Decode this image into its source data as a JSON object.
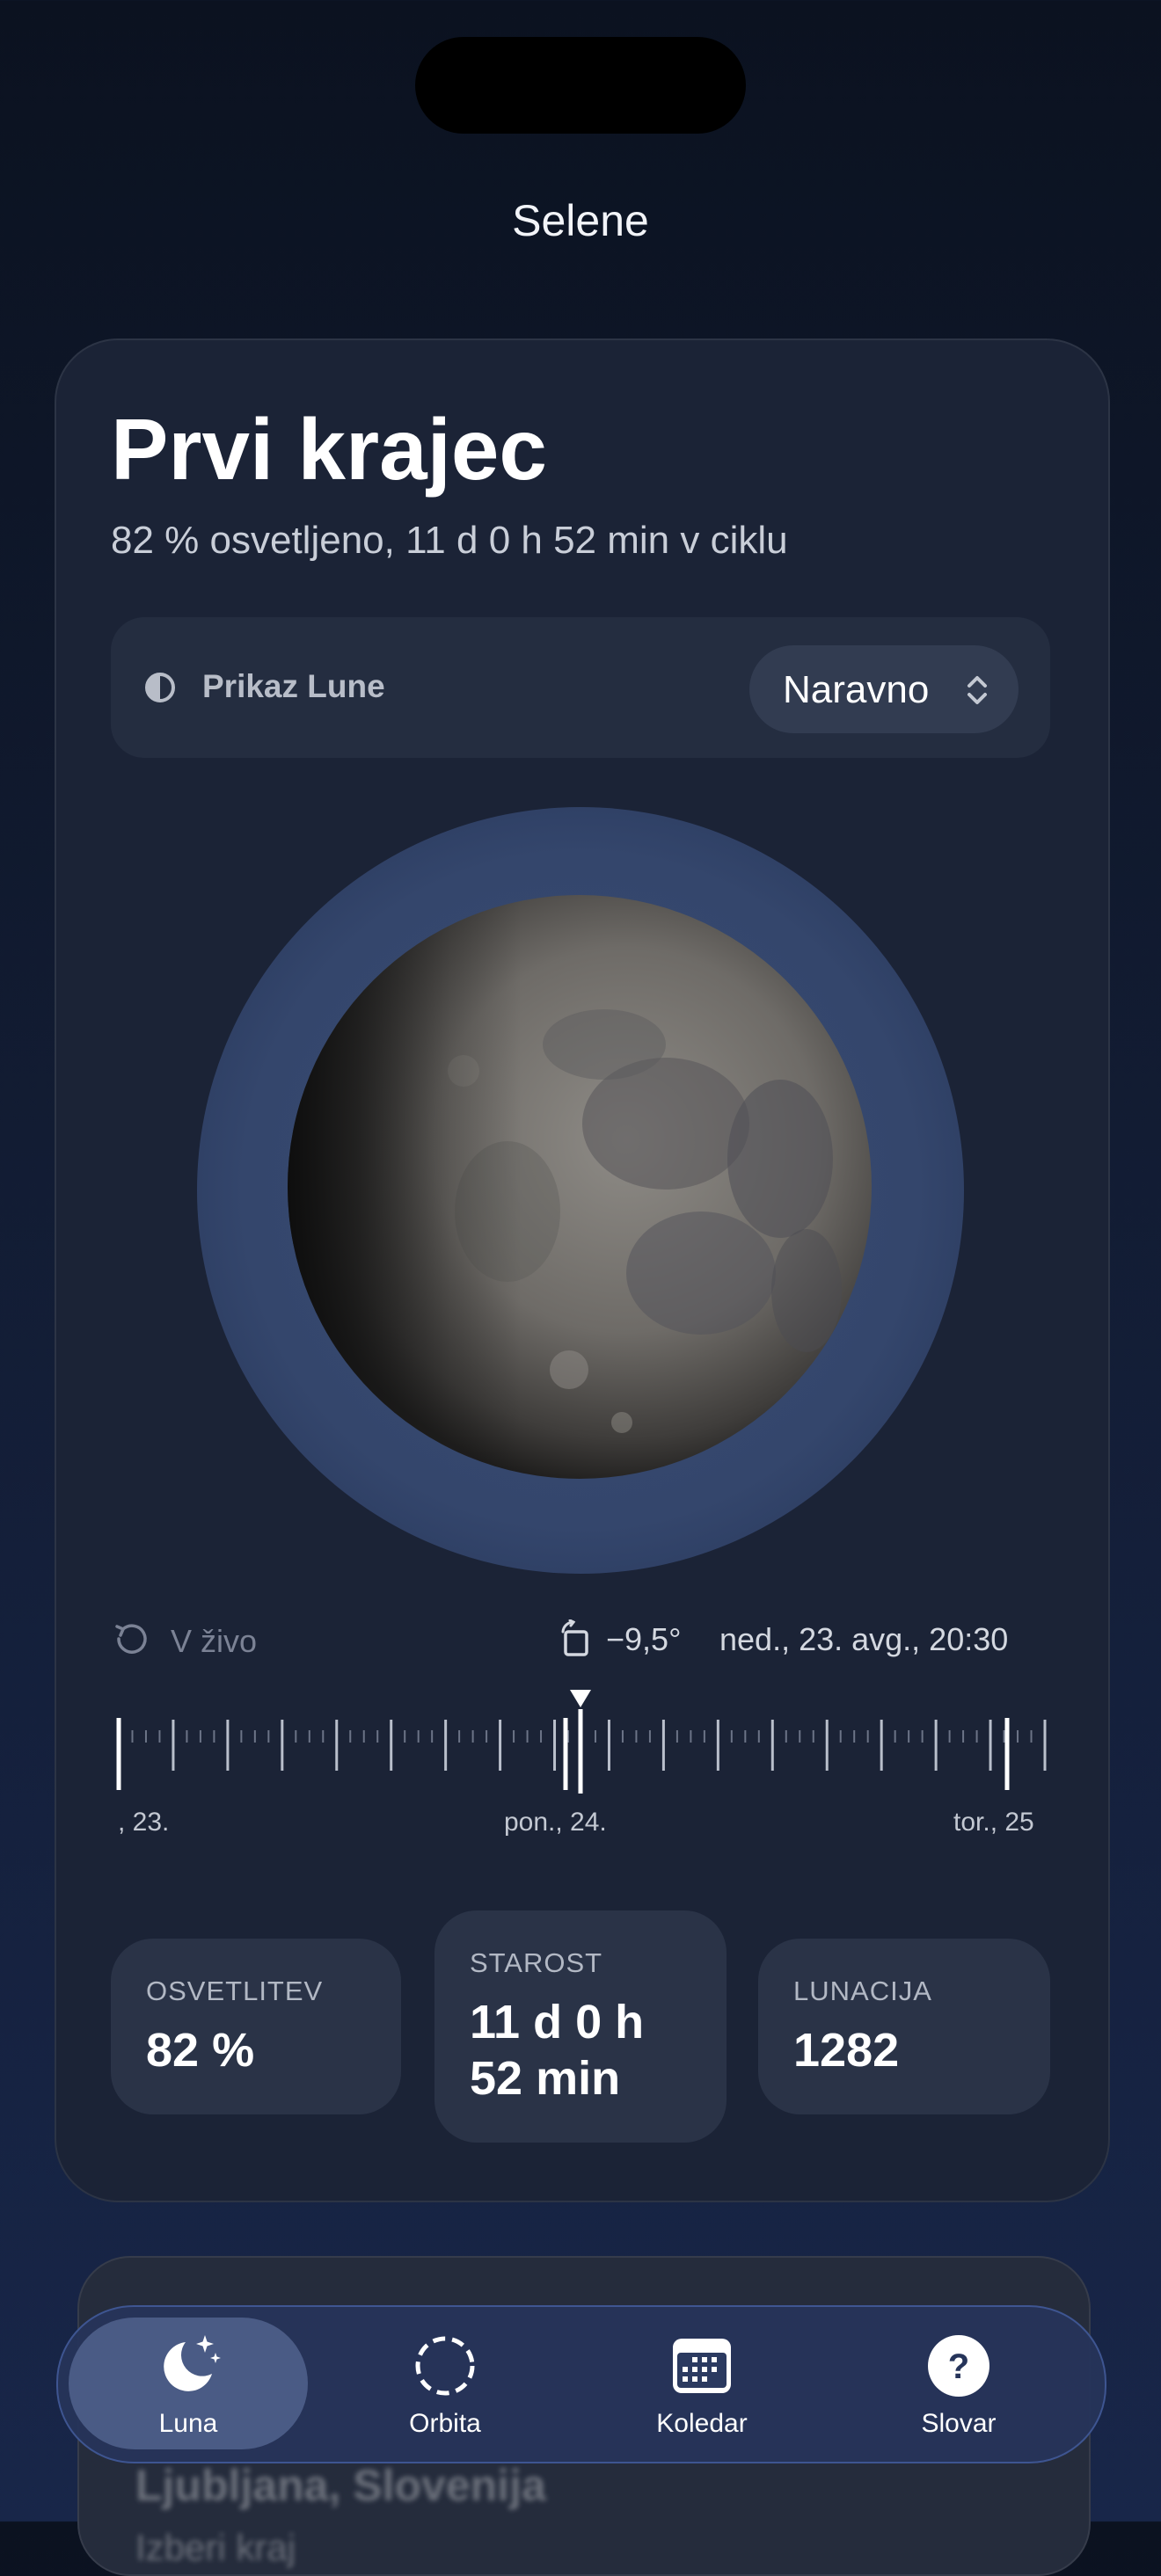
{
  "app": {
    "title": "Selene"
  },
  "phase": {
    "name": "Prvi krajec",
    "subtitle": "82 % osvetljeno, 11 d 0 h 52 min v ciklu"
  },
  "display": {
    "label": "Prikaz Lune",
    "mode": "Naravno"
  },
  "controls": {
    "live_label": "V živo",
    "tilt": "−9,5°",
    "datetime": "ned., 23. avg., 20:30"
  },
  "timeline": {
    "labels": [
      ", 23.",
      "pon., 24.",
      "tor., 25"
    ]
  },
  "stats": [
    {
      "label": "OSVETLITEV",
      "value": "82 %"
    },
    {
      "label": "STAROST",
      "value_line1": "11 d 0 h",
      "value_line2": "52 min"
    },
    {
      "label": "LUNACIJA",
      "value": "1282"
    }
  ],
  "location_card": {
    "line1": "Ljubljana, Slovenija",
    "line2": "Izberi kraj"
  },
  "tabs": [
    {
      "label": "Luna",
      "icon": "moon-stars-icon",
      "active": true
    },
    {
      "label": "Orbita",
      "icon": "orbit-dashed-circle-icon",
      "active": false
    },
    {
      "label": "Koledar",
      "icon": "calendar-icon",
      "active": false
    },
    {
      "label": "Slovar",
      "icon": "question-circle-icon",
      "active": false
    }
  ],
  "colors": {
    "background": "#0b1220",
    "card": "#1b2336",
    "halo": "#3a4c74",
    "tab_bar": "#26345a",
    "tab_active": "#4a5b85"
  }
}
